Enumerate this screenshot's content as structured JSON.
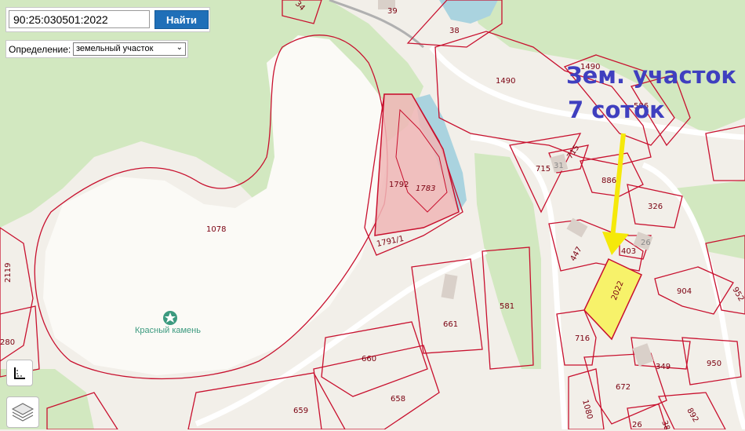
{
  "search": {
    "value": "90:25:030501:2022",
    "button_label": "Найти"
  },
  "definition": {
    "label": "Определение:",
    "selected": "земельный участок"
  },
  "annotation": {
    "line1": "Зем. участок -",
    "line2": "7 соток"
  },
  "poi": {
    "name": "Красный камень",
    "icon": "star-pin-icon"
  },
  "parcels": {
    "p34": "34",
    "p39": "39",
    "p38": "38",
    "p1490a": "1490",
    "p1490b": "1490",
    "p586": "586",
    "p715a": "715",
    "p715b": "715",
    "p31": "31",
    "p886": "886",
    "p326": "326",
    "p26": "26",
    "p403": "403",
    "p447": "447",
    "p2022": "2022",
    "p904": "904",
    "p952": "952",
    "p1792": "1792",
    "p1783": "1783",
    "p1791": "1791/1",
    "p1078": "1078",
    "p2119": "2119",
    "p280": "280",
    "p661": "661",
    "p581": "581",
    "p716": "716",
    "p660": "660",
    "p349": "349",
    "p950": "950",
    "p672": "672",
    "p659": "659",
    "p658": "658",
    "p1080": "1080",
    "p892": "892",
    "p38b": "38",
    "p26b": "26"
  },
  "colors": {
    "map_bg": "#f2efe9",
    "forest": "#d2e8c0",
    "parcel_border": "#c8102e",
    "selected_fill": "#f7f26a",
    "highlight_fill": "#f0b6b6",
    "water": "#aad3df",
    "annotation": "#3f3fbf",
    "arrow": "#f5e90a",
    "button": "#1f6fb8"
  },
  "tools": [
    "measure-icon",
    "layers-icon"
  ]
}
